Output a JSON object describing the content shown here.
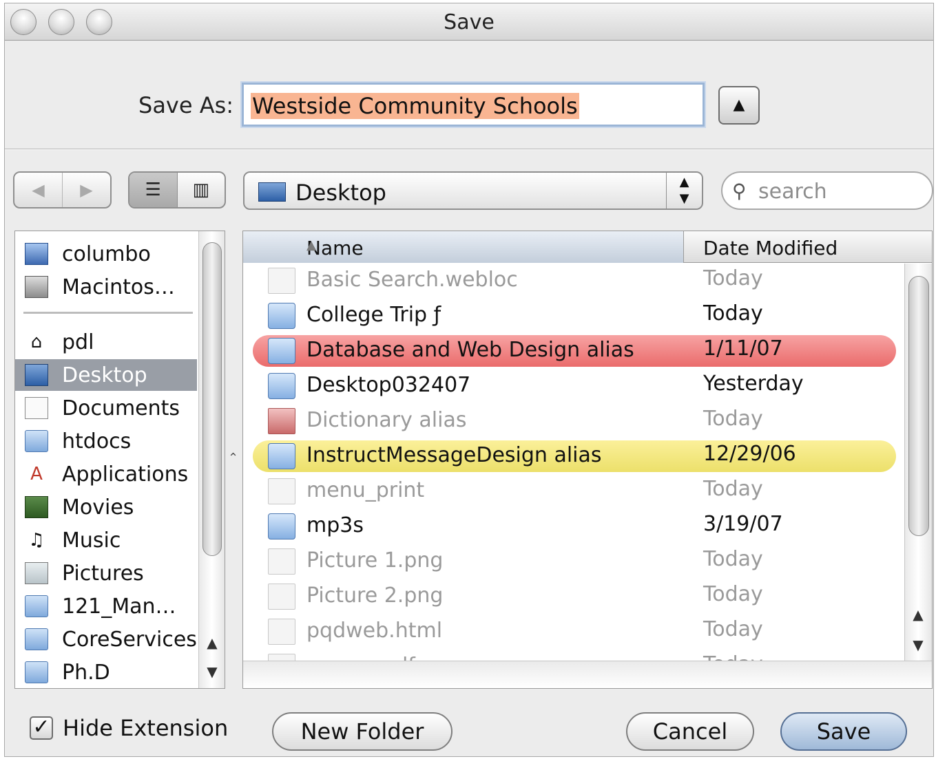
{
  "window": {
    "title": "Save"
  },
  "save_as": {
    "label": "Save As:",
    "value": "Westside Community Schools",
    "expand_glyph": "▲"
  },
  "toolbar": {
    "back_glyph": "◀",
    "forward_glyph": "▶",
    "list_view_glyph": "☰",
    "column_view_glyph": "▥",
    "location": "Desktop",
    "search_placeholder": "search"
  },
  "sidebar": {
    "devices": [
      {
        "label": "columbo",
        "icon": "computer-icon"
      },
      {
        "label": "Macintos…",
        "icon": "hard-disk-icon"
      }
    ],
    "places": [
      {
        "label": "pdl",
        "icon": "home-icon",
        "glyph": "⌂"
      },
      {
        "label": "Desktop",
        "icon": "desktop-icon",
        "selected": true
      },
      {
        "label": "Documents",
        "icon": "document-icon"
      },
      {
        "label": "htdocs",
        "icon": "folder-icon"
      },
      {
        "label": "Applications",
        "icon": "applications-icon",
        "glyph": "A"
      },
      {
        "label": "Movies",
        "icon": "movies-icon"
      },
      {
        "label": "Music",
        "icon": "music-icon",
        "glyph": "♫"
      },
      {
        "label": "Pictures",
        "icon": "pictures-icon"
      },
      {
        "label": "121_Man…",
        "icon": "folder-icon"
      },
      {
        "label": "CoreServices",
        "icon": "folder-icon"
      },
      {
        "label": "Ph.D",
        "icon": "folder-icon"
      }
    ]
  },
  "file_list": {
    "columns": {
      "name": "Name",
      "date": "Date Modified",
      "sort_glyph": "▲"
    },
    "rows": [
      {
        "name": "Basic Search.webloc",
        "date": "Today",
        "kind": "file",
        "dim": true
      },
      {
        "name": "College Trip ƒ",
        "date": "Today",
        "kind": "folder",
        "dim": false
      },
      {
        "name": "Database and Web Design alias",
        "date": "1/11/07",
        "kind": "folder",
        "dim": false,
        "label_color": "red"
      },
      {
        "name": "Desktop032407",
        "date": "Yesterday",
        "kind": "folder",
        "dim": false
      },
      {
        "name": "Dictionary alias",
        "date": "Today",
        "kind": "dict",
        "dim": true
      },
      {
        "name": "InstructMessageDesign alias",
        "date": "12/29/06",
        "kind": "folder",
        "dim": false,
        "label_color": "yellow"
      },
      {
        "name": "menu_print",
        "date": "Today",
        "kind": "file",
        "dim": true
      },
      {
        "name": "mp3s",
        "date": "3/19/07",
        "kind": "folder",
        "dim": false
      },
      {
        "name": "Picture 1.png",
        "date": "Today",
        "kind": "file",
        "dim": true
      },
      {
        "name": "Picture 2.png",
        "date": "Today",
        "kind": "file",
        "dim": true
      },
      {
        "name": "pqdweb.html",
        "date": "Today",
        "kind": "file",
        "dim": true
      },
      {
        "name": "source.pdf",
        "date": "Today",
        "kind": "file",
        "dim": true
      }
    ]
  },
  "footer": {
    "hide_extension_label": "Hide Extension",
    "hide_extension_checked": true,
    "new_folder": "New Folder",
    "cancel": "Cancel",
    "save": "Save"
  },
  "colors": {
    "selection_highlight": "#f9b592",
    "sidebar_selected": "#999ea6",
    "label_red": "#ea6b6b",
    "label_yellow": "#ece06a",
    "default_button": "#9fb9d8"
  }
}
